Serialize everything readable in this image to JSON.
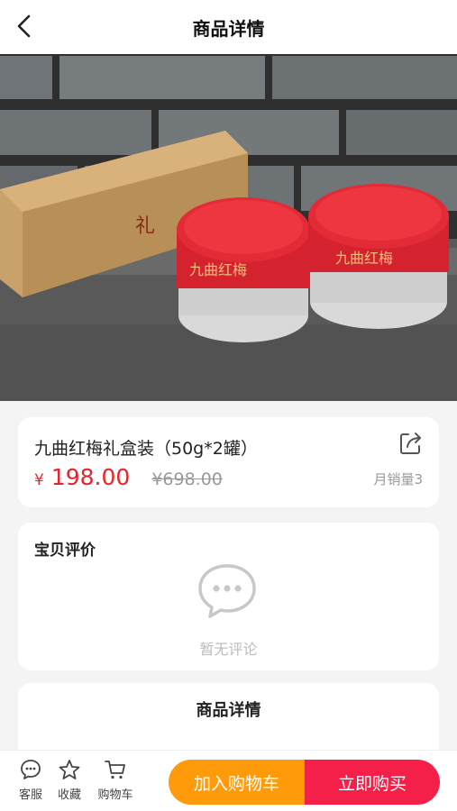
{
  "header": {
    "title": "商品详情"
  },
  "product": {
    "name": "九曲红梅礼盒装（50g*2罐）",
    "currency": "¥",
    "price": "198.00",
    "original_price": "¥698.00",
    "sales": "月销量3",
    "image_alt": "九曲红梅礼盒与两个红色茶罐"
  },
  "reviews": {
    "title": "宝贝评价",
    "empty_text": "暂无评论"
  },
  "detail": {
    "title": "商品详情"
  },
  "bottom_bar": {
    "service_label": "客服",
    "favorite_label": "收藏",
    "cart_label": "购物车",
    "add_to_cart_label": "加入购物车",
    "buy_now_label": "立即购买"
  },
  "colors": {
    "price_red": "#e8242b",
    "cart_orange": "#ff9b0b",
    "buy_red": "#f5204a"
  },
  "icons": {
    "back": "back-icon",
    "share": "share-icon",
    "empty_review": "chat-bubble-icon",
    "service": "chat-icon",
    "favorite": "star-icon",
    "cart": "cart-icon"
  }
}
